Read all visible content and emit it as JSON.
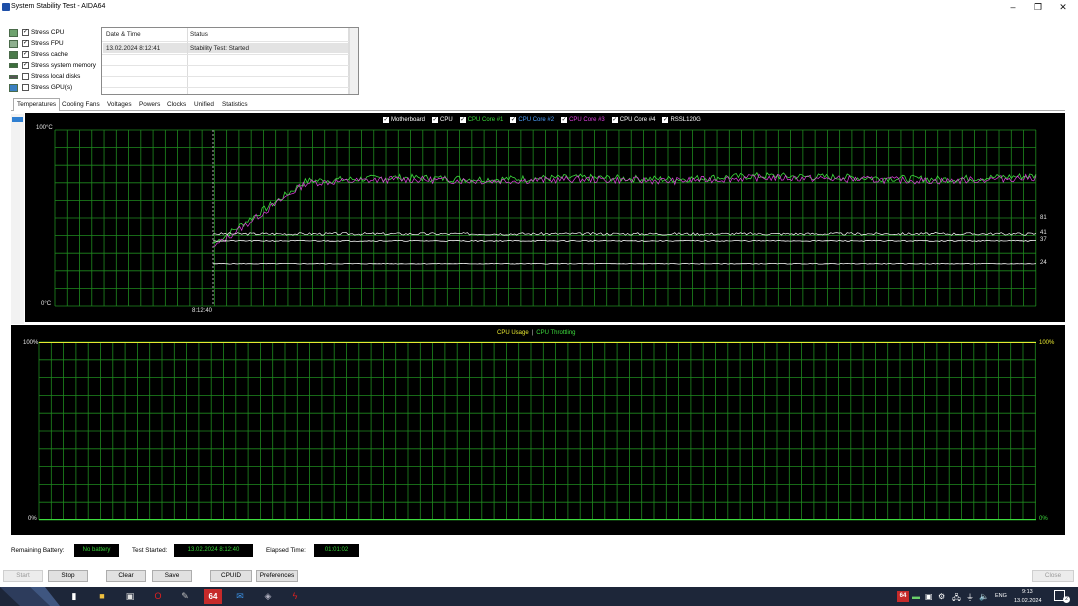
{
  "window": {
    "title": "System Stability Test - AIDA64"
  },
  "stress_options": [
    {
      "label": "Stress CPU",
      "checked": true
    },
    {
      "label": "Stress FPU",
      "checked": true
    },
    {
      "label": "Stress cache",
      "checked": true
    },
    {
      "label": "Stress system memory",
      "checked": true
    },
    {
      "label": "Stress local disks",
      "checked": false
    },
    {
      "label": "Stress GPU(s)",
      "checked": false
    }
  ],
  "status_table": {
    "headers": [
      "Date & Time",
      "Status"
    ],
    "rows": [
      {
        "datetime": "13.02.2024 8:12:41",
        "status": "Stability Test: Started"
      }
    ]
  },
  "tabs": [
    "Temperatures",
    "Cooling Fans",
    "Voltages",
    "Powers",
    "Clocks",
    "Unified",
    "Statistics"
  ],
  "active_tab": "Temperatures",
  "colors": {
    "grid": "#1f8a1f",
    "background": "#000000",
    "motherboard": "#ffffff",
    "cpu": "#ffffff",
    "core1": "#3ddc3d",
    "core2": "#4fa3ff",
    "core3": "#e040e0",
    "core4": "#ffffff",
    "ssd": "#ffffff",
    "cpu_usage": "#e8e830",
    "cpu_throttling": "#3ddc3d"
  },
  "temp_graph": {
    "legend": [
      {
        "label": "Motherboard",
        "color": "#ffffff"
      },
      {
        "label": "CPU",
        "color": "#ffffff"
      },
      {
        "label": "CPU Core #1",
        "color": "#3ddc3d"
      },
      {
        "label": "CPU Core #2",
        "color": "#4fa3ff"
      },
      {
        "label": "CPU Core #3",
        "color": "#e040e0"
      },
      {
        "label": "CPU Core #4",
        "color": "#ffffff"
      },
      {
        "label": "RSSL120G",
        "color": "#ffffff"
      }
    ],
    "y_top_label": "100°C",
    "y_bottom_label": "0°C",
    "time_label": "8:12:40",
    "right_values": [
      "81",
      "41",
      "37",
      "24"
    ]
  },
  "chart_data": {
    "type": "line",
    "title": "",
    "ylim": [
      0,
      100
    ],
    "series": [
      {
        "name": "CPU Core #1",
        "values": [
          36,
          71,
          73,
          72,
          73,
          72,
          74,
          73,
          72,
          74
        ]
      },
      {
        "name": "CPU Core #3",
        "values": [
          34,
          70,
          72,
          71,
          72,
          71,
          73,
          72,
          71,
          73
        ]
      },
      {
        "name": "RSSL120G",
        "values": [
          41,
          41,
          41,
          41,
          41,
          41,
          41,
          41,
          41,
          41
        ]
      },
      {
        "name": "Motherboard",
        "values": [
          37,
          37,
          37,
          37,
          37,
          37,
          37,
          37,
          37,
          37
        ]
      },
      {
        "name": "CPU",
        "values": [
          24,
          24,
          24,
          24,
          24,
          24,
          24,
          24,
          24,
          24
        ]
      }
    ]
  },
  "usage_graph": {
    "legend": [
      {
        "label": "CPU Usage",
        "color": "#e8e830"
      },
      {
        "label": "CPU Throttling",
        "color": "#3ddc3d"
      }
    ],
    "separator": "|",
    "y_top_label": "100%",
    "y_bottom_label": "0%",
    "right_top_label": "100%",
    "right_bottom_label": "0%"
  },
  "footer": {
    "remaining_battery_label": "Remaining Battery:",
    "remaining_battery_value": "No battery",
    "test_started_label": "Test Started:",
    "test_started_value": "13.02.2024 8:12:40",
    "elapsed_label": "Elapsed Time:",
    "elapsed_value": "01:01:02"
  },
  "buttons": {
    "start": "Start",
    "stop": "Stop",
    "clear": "Clear",
    "save": "Save",
    "cpuid": "CPUID",
    "preferences": "Preferences",
    "close": "Close"
  },
  "taskbar": {
    "lang": "ENG",
    "time": "9:13",
    "date": "13.02.2024",
    "notif_count": "2",
    "aida_label": "64",
    "tray_aida_label": "64"
  }
}
